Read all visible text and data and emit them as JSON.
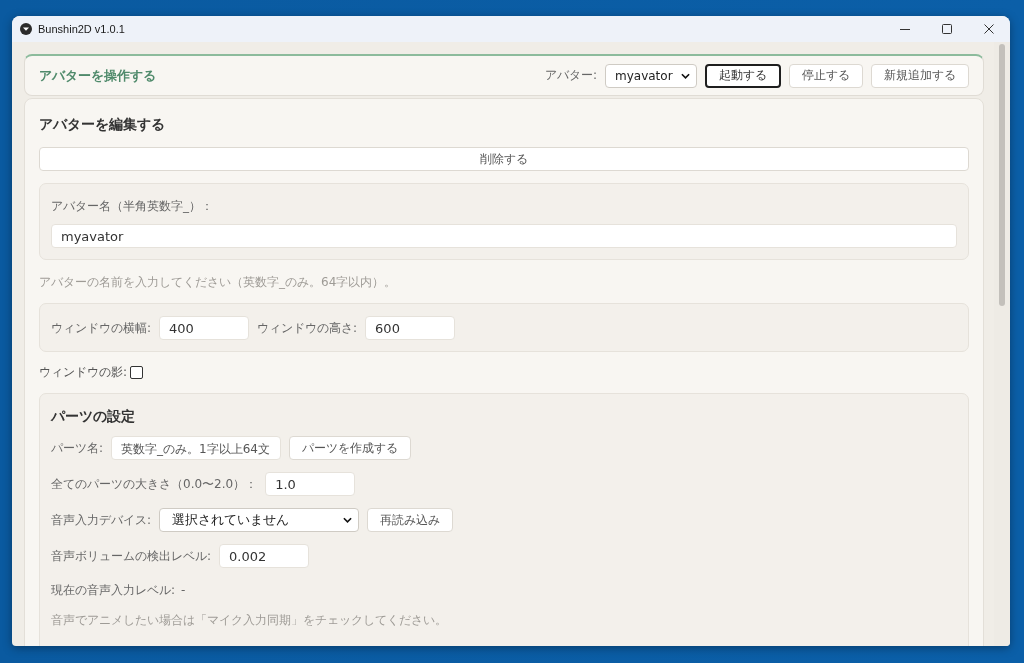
{
  "window": {
    "title": "Bunshin2D v1.0.1"
  },
  "control_panel": {
    "title": "アバターを操作する",
    "avatar_label": "アバター:",
    "avatar_select": {
      "value": "myavator"
    },
    "buttons": [
      {
        "label": "起動する",
        "focused": true
      },
      {
        "label": "停止する",
        "focused": false
      },
      {
        "label": "新規追加する",
        "focused": false
      }
    ]
  },
  "editor": {
    "title": "アバターを編集する",
    "delete_button": "削除する",
    "name_group": {
      "label": "アバター名（半角英数字_）：",
      "value": "myavator"
    },
    "name_hint": "アバターの名前を入力してください（英数字_のみ。64字以内）。",
    "size_fields": [
      {
        "label": "ウィンドウの横幅:",
        "value": "400"
      },
      {
        "label": "ウィンドウの高さ:",
        "value": "600"
      }
    ],
    "shadow": {
      "label": "ウィンドウの影:",
      "checked": false
    },
    "parts": {
      "title": "パーツの設定",
      "rows": [
        {
          "kind": "input",
          "label": "パーツ名:",
          "placeholder": "英数字_のみ。1字以上64文",
          "button": "パーツを作成する"
        },
        {
          "kind": "input",
          "label": "全てのパーツの大きさ（0.0〜2.0）：",
          "value": "1.0"
        },
        {
          "kind": "select",
          "label": "音声入力デバイス:",
          "value": "選択されていません",
          "button": "再読み込み"
        },
        {
          "kind": "input",
          "label": "音声ボリュームの検出レベル:",
          "value": "0.002"
        },
        {
          "kind": "text",
          "label": "現在の音声入力レベル:",
          "reading": "-"
        }
      ],
      "hint": "音声でアニメしたい場合は「マイク入力同期」をチェックしてください。"
    }
  }
}
